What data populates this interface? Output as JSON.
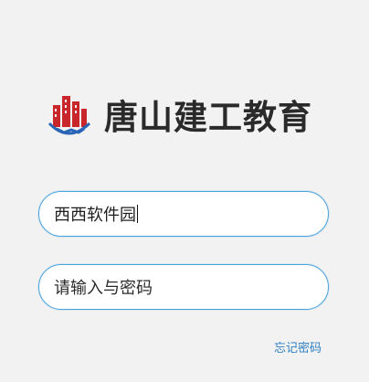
{
  "brand": {
    "name": "唐山建工教育",
    "logo_icon": "buildings-handshake-logo-icon",
    "logo_color": "#c8262b",
    "logo_accent": "#2a64b7"
  },
  "login": {
    "username_value": "西西软件园",
    "password_placeholder": "请输入与密码",
    "forgot_label": "忘记密码"
  },
  "colors": {
    "field_border": "#4aa3df",
    "link": "#2f7fc2",
    "background": "#f2f2f2"
  }
}
